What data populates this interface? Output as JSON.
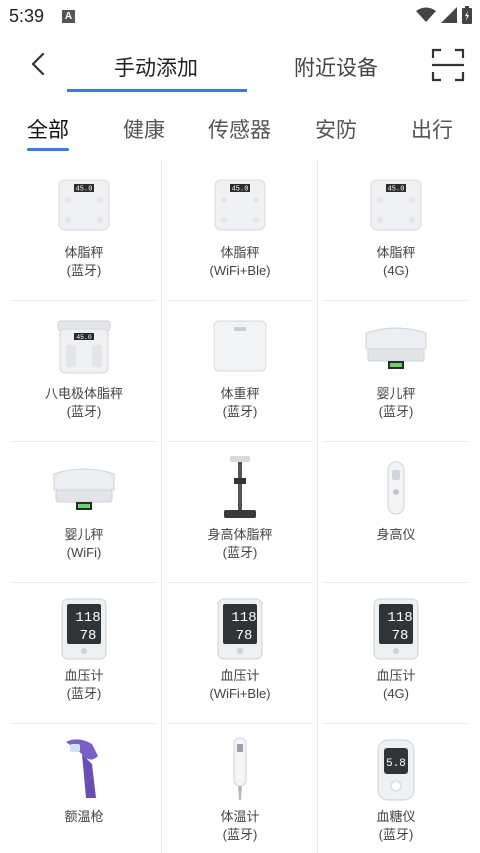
{
  "status_bar": {
    "time": "5:39",
    "notification_letter": "A"
  },
  "header": {
    "tab_manual": "手动添加",
    "tab_nearby": "附近设备"
  },
  "categories": [
    "全部",
    "健康",
    "传感器",
    "安防",
    "出行"
  ],
  "devices": [
    {
      "name": "体脂秤",
      "sub": "(蓝牙)",
      "icon": "body-fat-scale-icon",
      "screen_text": "45.0"
    },
    {
      "name": "体脂秤",
      "sub": "(WiFi+Ble)",
      "icon": "body-fat-scale-icon",
      "screen_text": "45.0"
    },
    {
      "name": "体脂秤",
      "sub": "(4G)",
      "icon": "body-fat-scale-icon",
      "screen_text": "45.0"
    },
    {
      "name": "八电极体脂秤",
      "sub": "(蓝牙)",
      "icon": "eight-electrode-scale-icon",
      "screen_text": "45.0"
    },
    {
      "name": "体重秤",
      "sub": "(蓝牙)",
      "icon": "weight-scale-icon"
    },
    {
      "name": "婴儿秤",
      "sub": "(蓝牙)",
      "icon": "baby-scale-icon"
    },
    {
      "name": "婴儿秤",
      "sub": "(WiFi)",
      "icon": "baby-scale-icon"
    },
    {
      "name": "身高体脂秤",
      "sub": "(蓝牙)",
      "icon": "height-fat-scale-icon"
    },
    {
      "name": "身高仪",
      "sub": "",
      "icon": "height-meter-icon"
    },
    {
      "name": "血压计",
      "sub": "(蓝牙)",
      "icon": "blood-pressure-monitor-icon",
      "screen_top": "118",
      "screen_bottom": "78"
    },
    {
      "name": "血压计",
      "sub": "(WiFi+Ble)",
      "icon": "blood-pressure-monitor-icon",
      "screen_top": "118",
      "screen_bottom": "78"
    },
    {
      "name": "血压计",
      "sub": "(4G)",
      "icon": "blood-pressure-monitor-icon",
      "screen_top": "118",
      "screen_bottom": "78"
    },
    {
      "name": "额温枪",
      "sub": "",
      "icon": "forehead-thermometer-icon"
    },
    {
      "name": "体温计",
      "sub": "(蓝牙)",
      "icon": "thermometer-icon"
    },
    {
      "name": "血糖仪",
      "sub": "(蓝牙)",
      "icon": "glucose-meter-icon",
      "screen_text": "5.8"
    }
  ],
  "colors": {
    "accent": "#3a7bd5"
  }
}
